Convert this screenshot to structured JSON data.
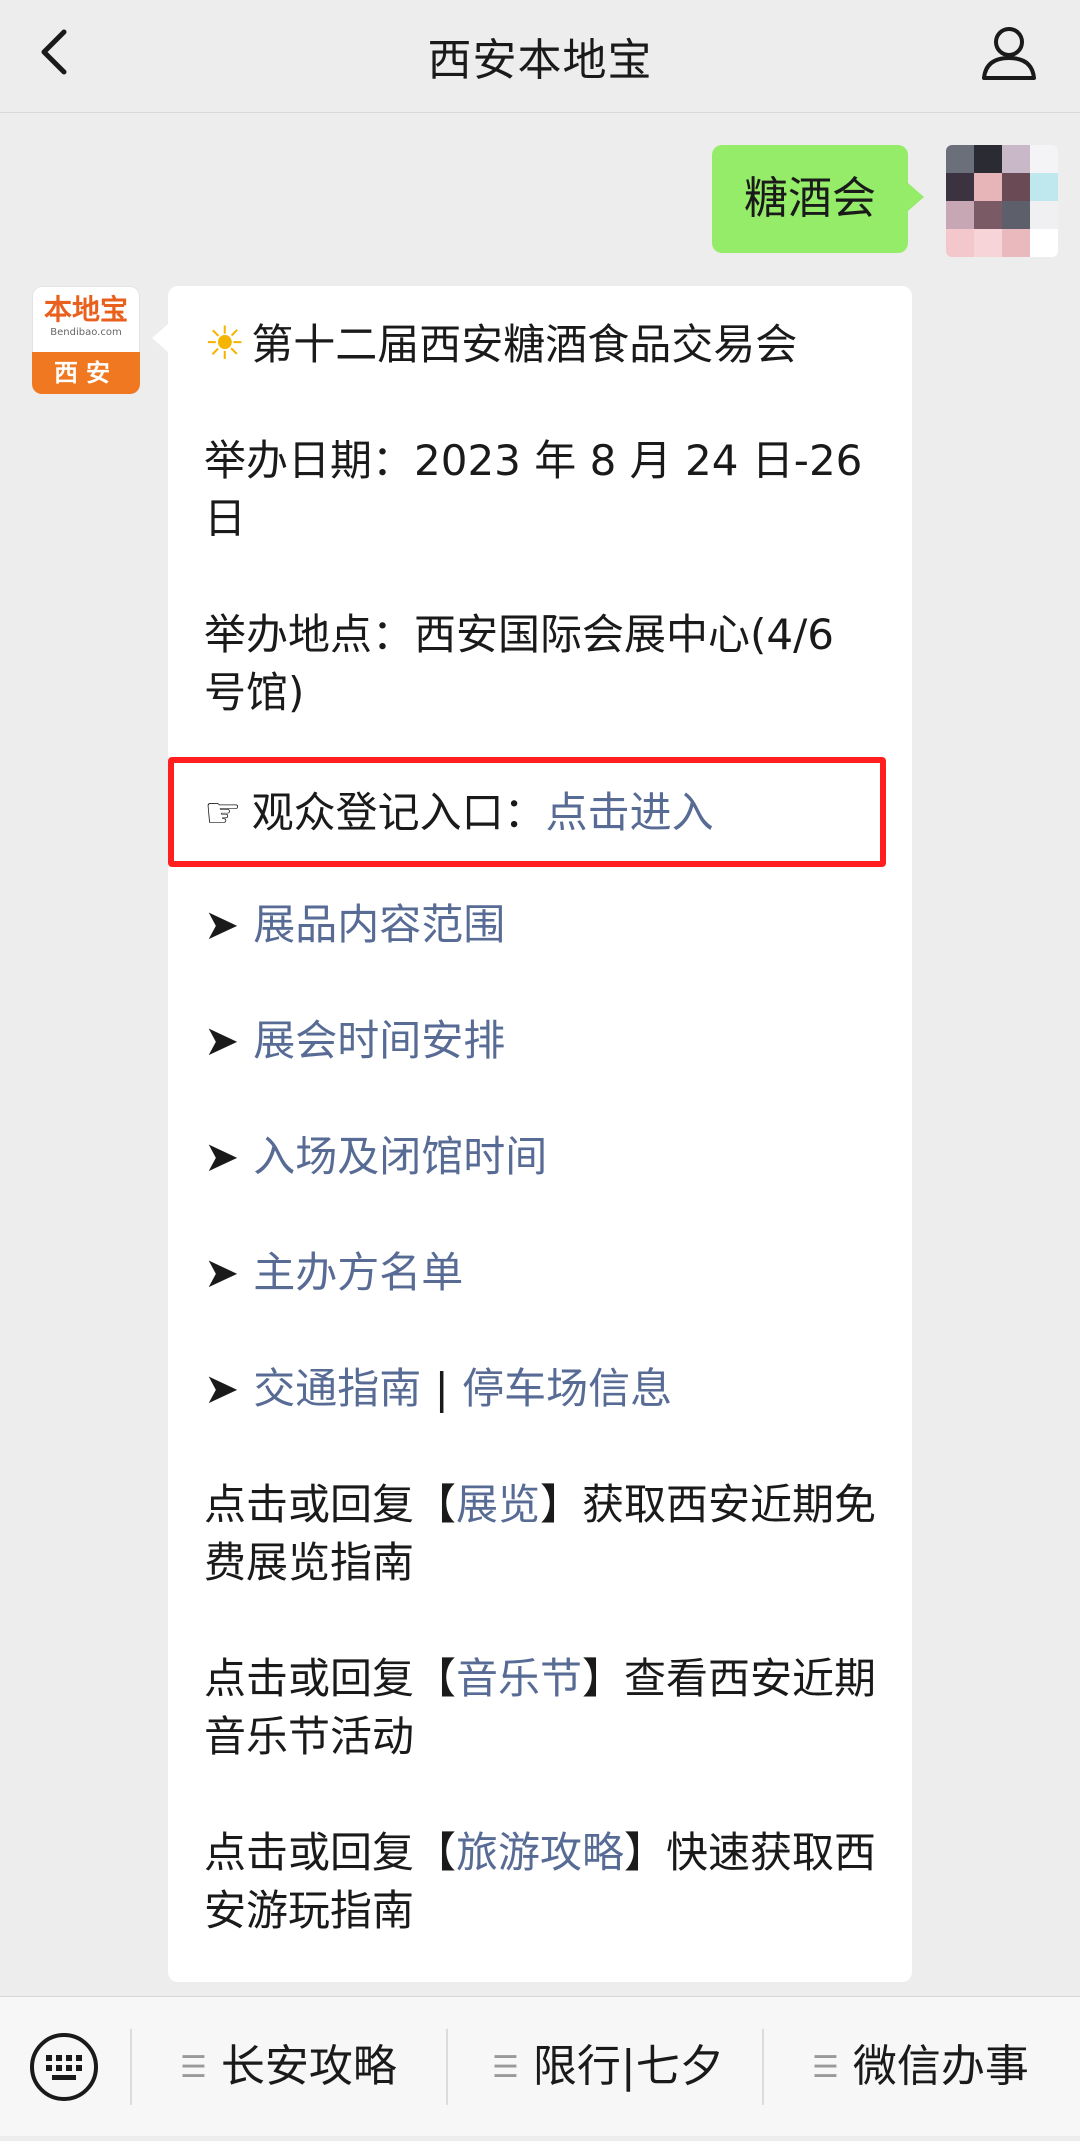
{
  "header": {
    "title": "西安本地宝",
    "back_icon": "chevron-left-icon",
    "profile_icon": "person-icon"
  },
  "user_message": {
    "text": "糖酒会",
    "bubble_color": "#95ec69"
  },
  "bot_avatar": {
    "logo_main": "本地宝",
    "logo_sub": "Bendibao.com",
    "logo_city": "西安"
  },
  "bot_message": {
    "title": "第十二届西安糖酒食品交易会",
    "date_line": "举办日期：2023 年 8 月 24 日-26 日",
    "venue_line": "举办地点：西安国际会展中心(4/6 号馆)",
    "entry": {
      "label": "观众登记入口：",
      "link": "点击进入"
    },
    "links": [
      {
        "text": "展品内容范围"
      },
      {
        "text": "展会时间安排"
      },
      {
        "text": "入场及闭馆时间"
      },
      {
        "text": "主办方名单"
      }
    ],
    "traffic": {
      "link1": "交通指南",
      "sep": " | ",
      "link2": "停车场信息"
    },
    "promos": [
      {
        "prefix": "点击或回复【",
        "keyword": "展览",
        "suffix": "】获取西安近期免费展览指南"
      },
      {
        "prefix": "点击或回复【",
        "keyword": "音乐节",
        "suffix": "】查看西安近期音乐节活动"
      },
      {
        "prefix": "点击或回复【",
        "keyword": "旅游攻略",
        "suffix": "】快速获取西安游玩指南"
      }
    ],
    "link_color": "#576b95",
    "highlight_color": "#ff1f1f"
  },
  "bottom_menu": {
    "keyboard_icon": "keyboard-icon",
    "items": [
      {
        "label": "长安攻略"
      },
      {
        "label": "限行|七夕"
      },
      {
        "label": "微信办事"
      }
    ]
  }
}
